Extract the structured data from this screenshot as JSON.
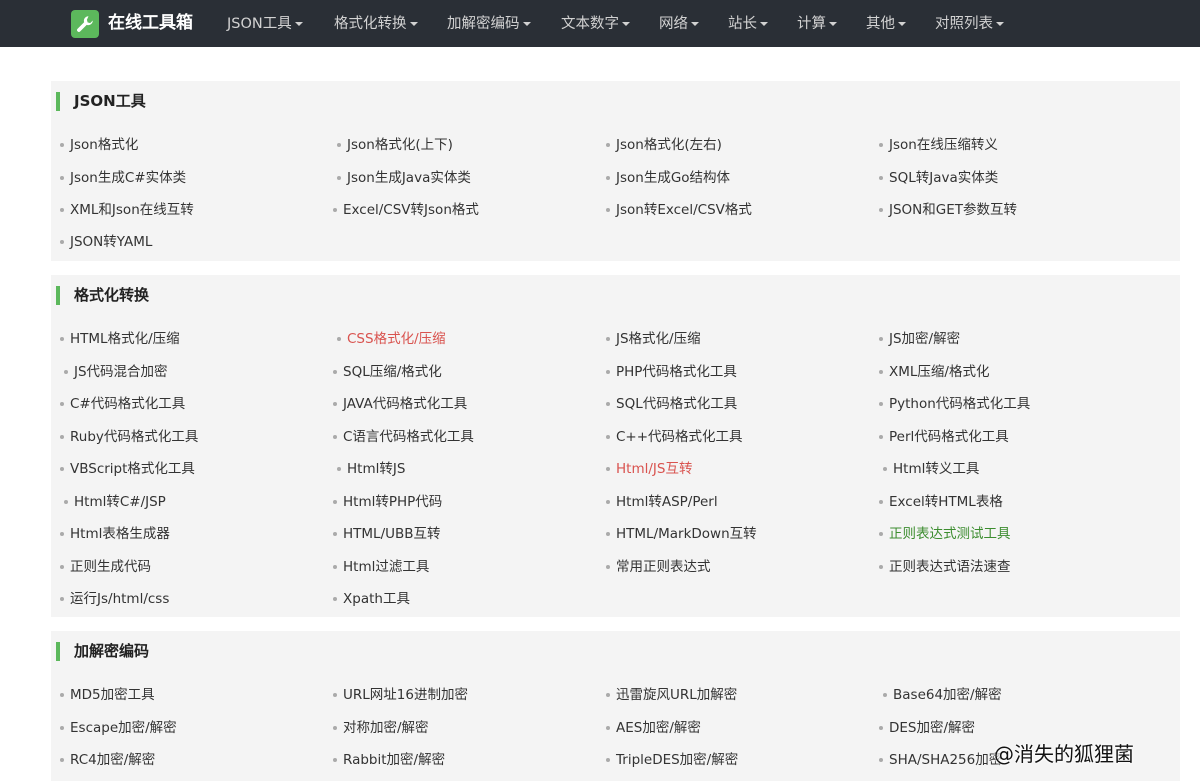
{
  "brand": "在线工具箱",
  "nav": [
    {
      "label": "JSON工具"
    },
    {
      "label": "格式化转换"
    },
    {
      "label": "加解密编码"
    },
    {
      "label": "文本数字"
    },
    {
      "label": "网络"
    },
    {
      "label": "站长"
    },
    {
      "label": "计算"
    },
    {
      "label": "其他"
    },
    {
      "label": "对照列表"
    }
  ],
  "sections": [
    {
      "title": "JSON工具",
      "tools": [
        "Json格式化",
        "Json格式化(上下)",
        "Json格式化(左右)",
        "Json在线压缩转义",
        "Json生成C#实体类",
        "Json生成Java实体类",
        "Json生成Go结构体",
        "SQL转Java实体类",
        "XML和Json在线互转",
        "Excel/CSV转Json格式",
        "Json转Excel/CSV格式",
        "JSON和GET参数互转",
        "JSON转YAML"
      ]
    },
    {
      "title": "格式化转换",
      "tools": [
        "HTML格式化/压缩",
        "CSS格式化/压缩",
        "JS格式化/压缩",
        "JS加密/解密",
        "JS代码混合加密",
        "SQL压缩/格式化",
        "PHP代码格式化工具",
        "XML压缩/格式化",
        "C#代码格式化工具",
        "JAVA代码格式化工具",
        "SQL代码格式化工具",
        "Python代码格式化工具",
        "Ruby代码格式化工具",
        "C语言代码格式化工具",
        "C++代码格式化工具",
        "Perl代码格式化工具",
        "VBScript格式化工具",
        "Html转JS",
        "Html/JS互转",
        "Html转义工具",
        "Html转C#/JSP",
        "Html转PHP代码",
        "Html转ASP/Perl",
        "Excel转HTML表格",
        "Html表格生成器",
        "HTML/UBB互转",
        "HTML/MarkDown互转",
        "正则表达式测试工具",
        "正则生成代码",
        "Html过滤工具",
        "常用正则表达式",
        "正则表达式语法速查",
        "运行Js/html/css",
        "Xpath工具"
      ]
    },
    {
      "title": "加解密编码",
      "tools": [
        "MD5加密工具",
        "URL网址16进制加密",
        "迅雷旋风URL加解密",
        "Base64加密/解密",
        "Escape加密/解密",
        "对称加密/解密",
        "AES加密/解密",
        "DES加密/解密",
        "RC4加密/解密",
        "Rabbit加密/解密",
        "TripleDES加密/解密",
        "SHA/SHA256加密"
      ]
    }
  ],
  "colors": {
    "navbar_bg": "#2a2f36",
    "accent_green": "#5cb85c",
    "highlight_red": "#d9534f",
    "highlight_green": "#3c8d2f",
    "section_bg": "#f4f4f4"
  },
  "icons": {
    "brand": "wrench-icon"
  },
  "watermark": "@消失的狐狸菌"
}
